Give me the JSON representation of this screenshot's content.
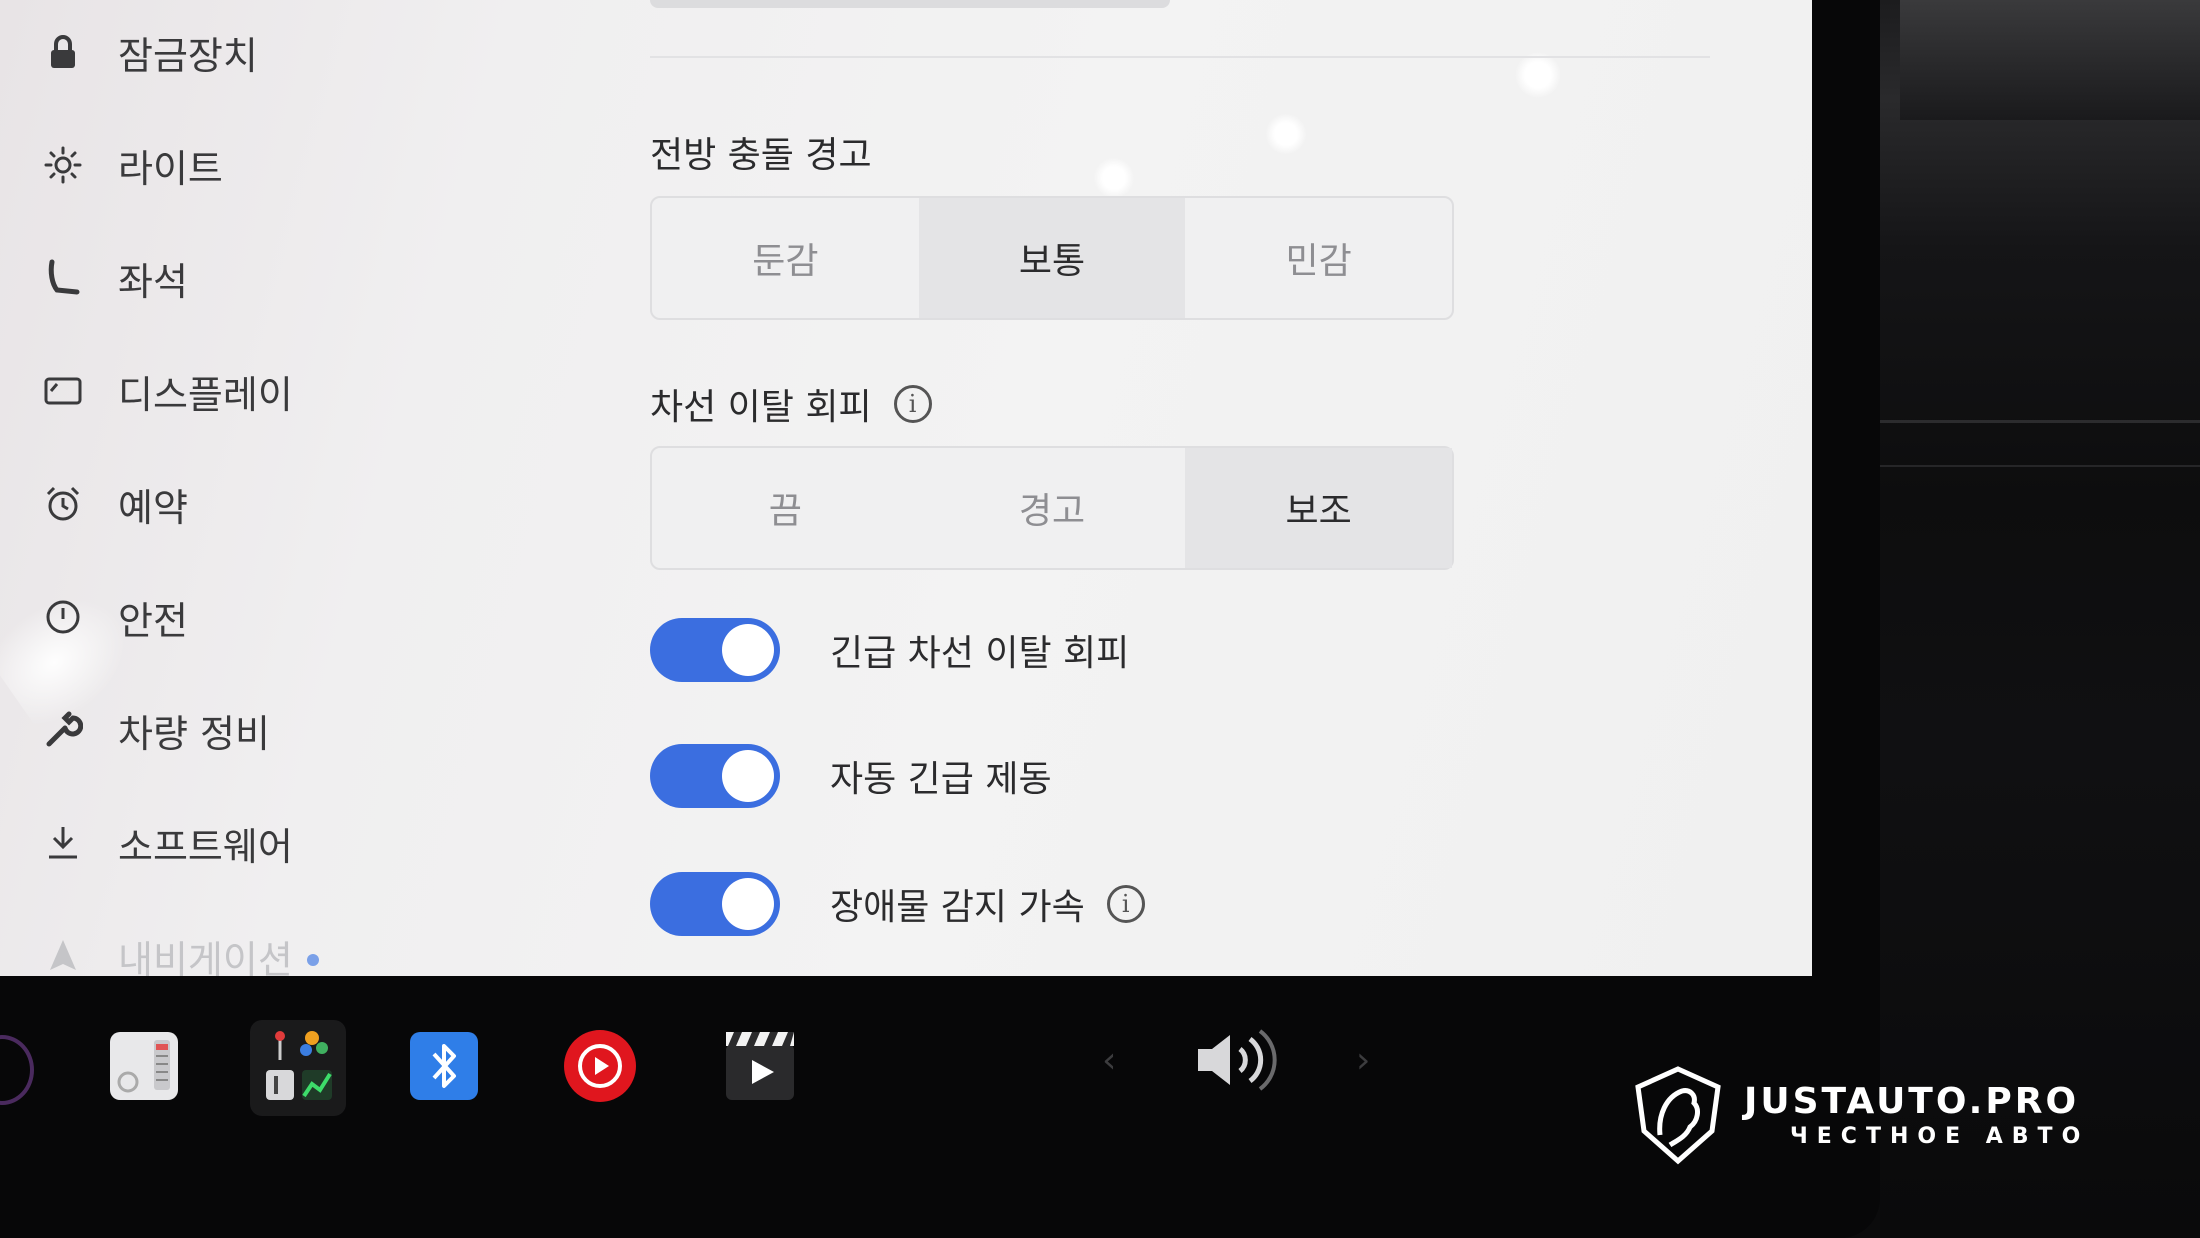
{
  "sidebar": {
    "items": [
      {
        "label": "잠금장치",
        "icon": "lock-icon"
      },
      {
        "label": "라이트",
        "icon": "sun-icon"
      },
      {
        "label": "좌석",
        "icon": "seat-icon"
      },
      {
        "label": "디스플레이",
        "icon": "display-icon"
      },
      {
        "label": "예약",
        "icon": "alarm-icon"
      },
      {
        "label": "안전",
        "icon": "alert-circle-icon"
      },
      {
        "label": "차량 정비",
        "icon": "wrench-icon"
      },
      {
        "label": "소프트웨어",
        "icon": "download-icon"
      },
      {
        "label": "내비게이션",
        "icon": "navigation-icon"
      }
    ]
  },
  "forward_collision": {
    "title": "전방 충돌 경고",
    "options": [
      "둔감",
      "보통",
      "민감"
    ],
    "selected": "보통"
  },
  "lane_departure": {
    "title": "차선 이탈 회피",
    "options": [
      "끔",
      "경고",
      "보조"
    ],
    "selected": "보조"
  },
  "toggles": [
    {
      "label": "긴급 차선 이탈 회피",
      "on": true,
      "info": false
    },
    {
      "label": "자동 긴급 제동",
      "on": true,
      "info": false
    },
    {
      "label": "장애물 감지 가속",
      "on": true,
      "info": true
    }
  ],
  "taskbar": {
    "apps": [
      "toybox-app-icon",
      "apps-launcher-icon",
      "bluetooth-icon",
      "youtube-music-icon",
      "theater-icon"
    ],
    "volume_icon": "volume-icon"
  },
  "watermark": {
    "title": "JUSTAUTO.PRO",
    "subtitle": "ЧЕСТНОЕ АВТО"
  },
  "colors": {
    "toggle_on": "#3b6ee0",
    "accent_red": "#e0161e",
    "bluetooth_blue": "#2f7ee8"
  }
}
